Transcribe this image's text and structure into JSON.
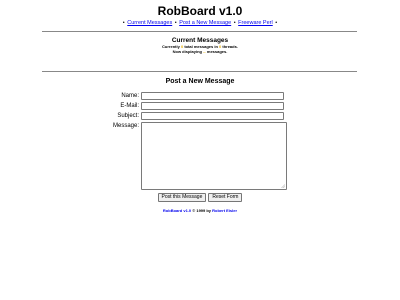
{
  "page": {
    "title": "RobBoard v1.0"
  },
  "nav": {
    "separator": "•",
    "links": [
      {
        "label": "Current Messages"
      },
      {
        "label": "Post a New Message"
      },
      {
        "label": "Freeware Perl"
      }
    ]
  },
  "current_messages": {
    "title": "Current Messages",
    "stats_line1": {
      "prefix": "Currently",
      "total_count": "0",
      "middle": "total messages in",
      "thread_count": "0",
      "suffix": "threads."
    },
    "stats_line2": {
      "prefix": "Now displaying",
      "displayed_count": "--",
      "suffix": "messages."
    }
  },
  "post_form": {
    "title": "Post a New Message",
    "fields": {
      "name": {
        "label": "Name:",
        "value": ""
      },
      "email": {
        "label": "E-Mail:",
        "value": ""
      },
      "subject": {
        "label": "Subject:",
        "value": ""
      },
      "message": {
        "label": "Message:",
        "value": ""
      }
    },
    "submit_label": "Post this Message",
    "reset_label": "Reset Form"
  },
  "footer": {
    "product": "RobBoard v1.0",
    "copyright": "© 1999 by",
    "author": "Robert Eisler"
  },
  "colors": {
    "link": "#0000ee",
    "count_highlight": "#e8b000",
    "rule": "#888888"
  },
  "icons": {
    "resize_grip": "resize-grip-icon"
  }
}
